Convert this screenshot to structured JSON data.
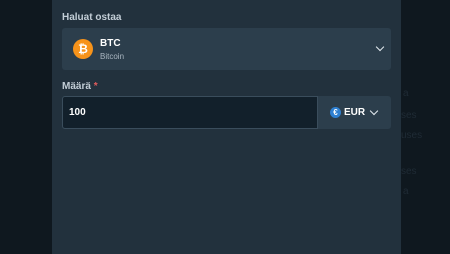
{
  "buy": {
    "label": "Haluat ostaa",
    "asset": {
      "symbol": "BTC",
      "name": "Bitcoin",
      "icon_glyph": "₿",
      "icon": "bitcoin-icon",
      "icon_color": "#f7931a"
    }
  },
  "amount": {
    "label": "Määrä",
    "required_mark": "*",
    "value": "100",
    "currency": {
      "code": "EUR",
      "icon_glyph": "€",
      "icon": "euro-icon",
      "icon_color": "#2f80d1"
    }
  },
  "background_fragments": {
    "f1": "a",
    "f2": "ses",
    "f3": "uses",
    "f4": "ses",
    "f5": "a"
  },
  "colors": {
    "panel": "#22313d",
    "backdrop": "#0f181f",
    "field": "#2c3e4c",
    "required": "#e25c5c"
  }
}
